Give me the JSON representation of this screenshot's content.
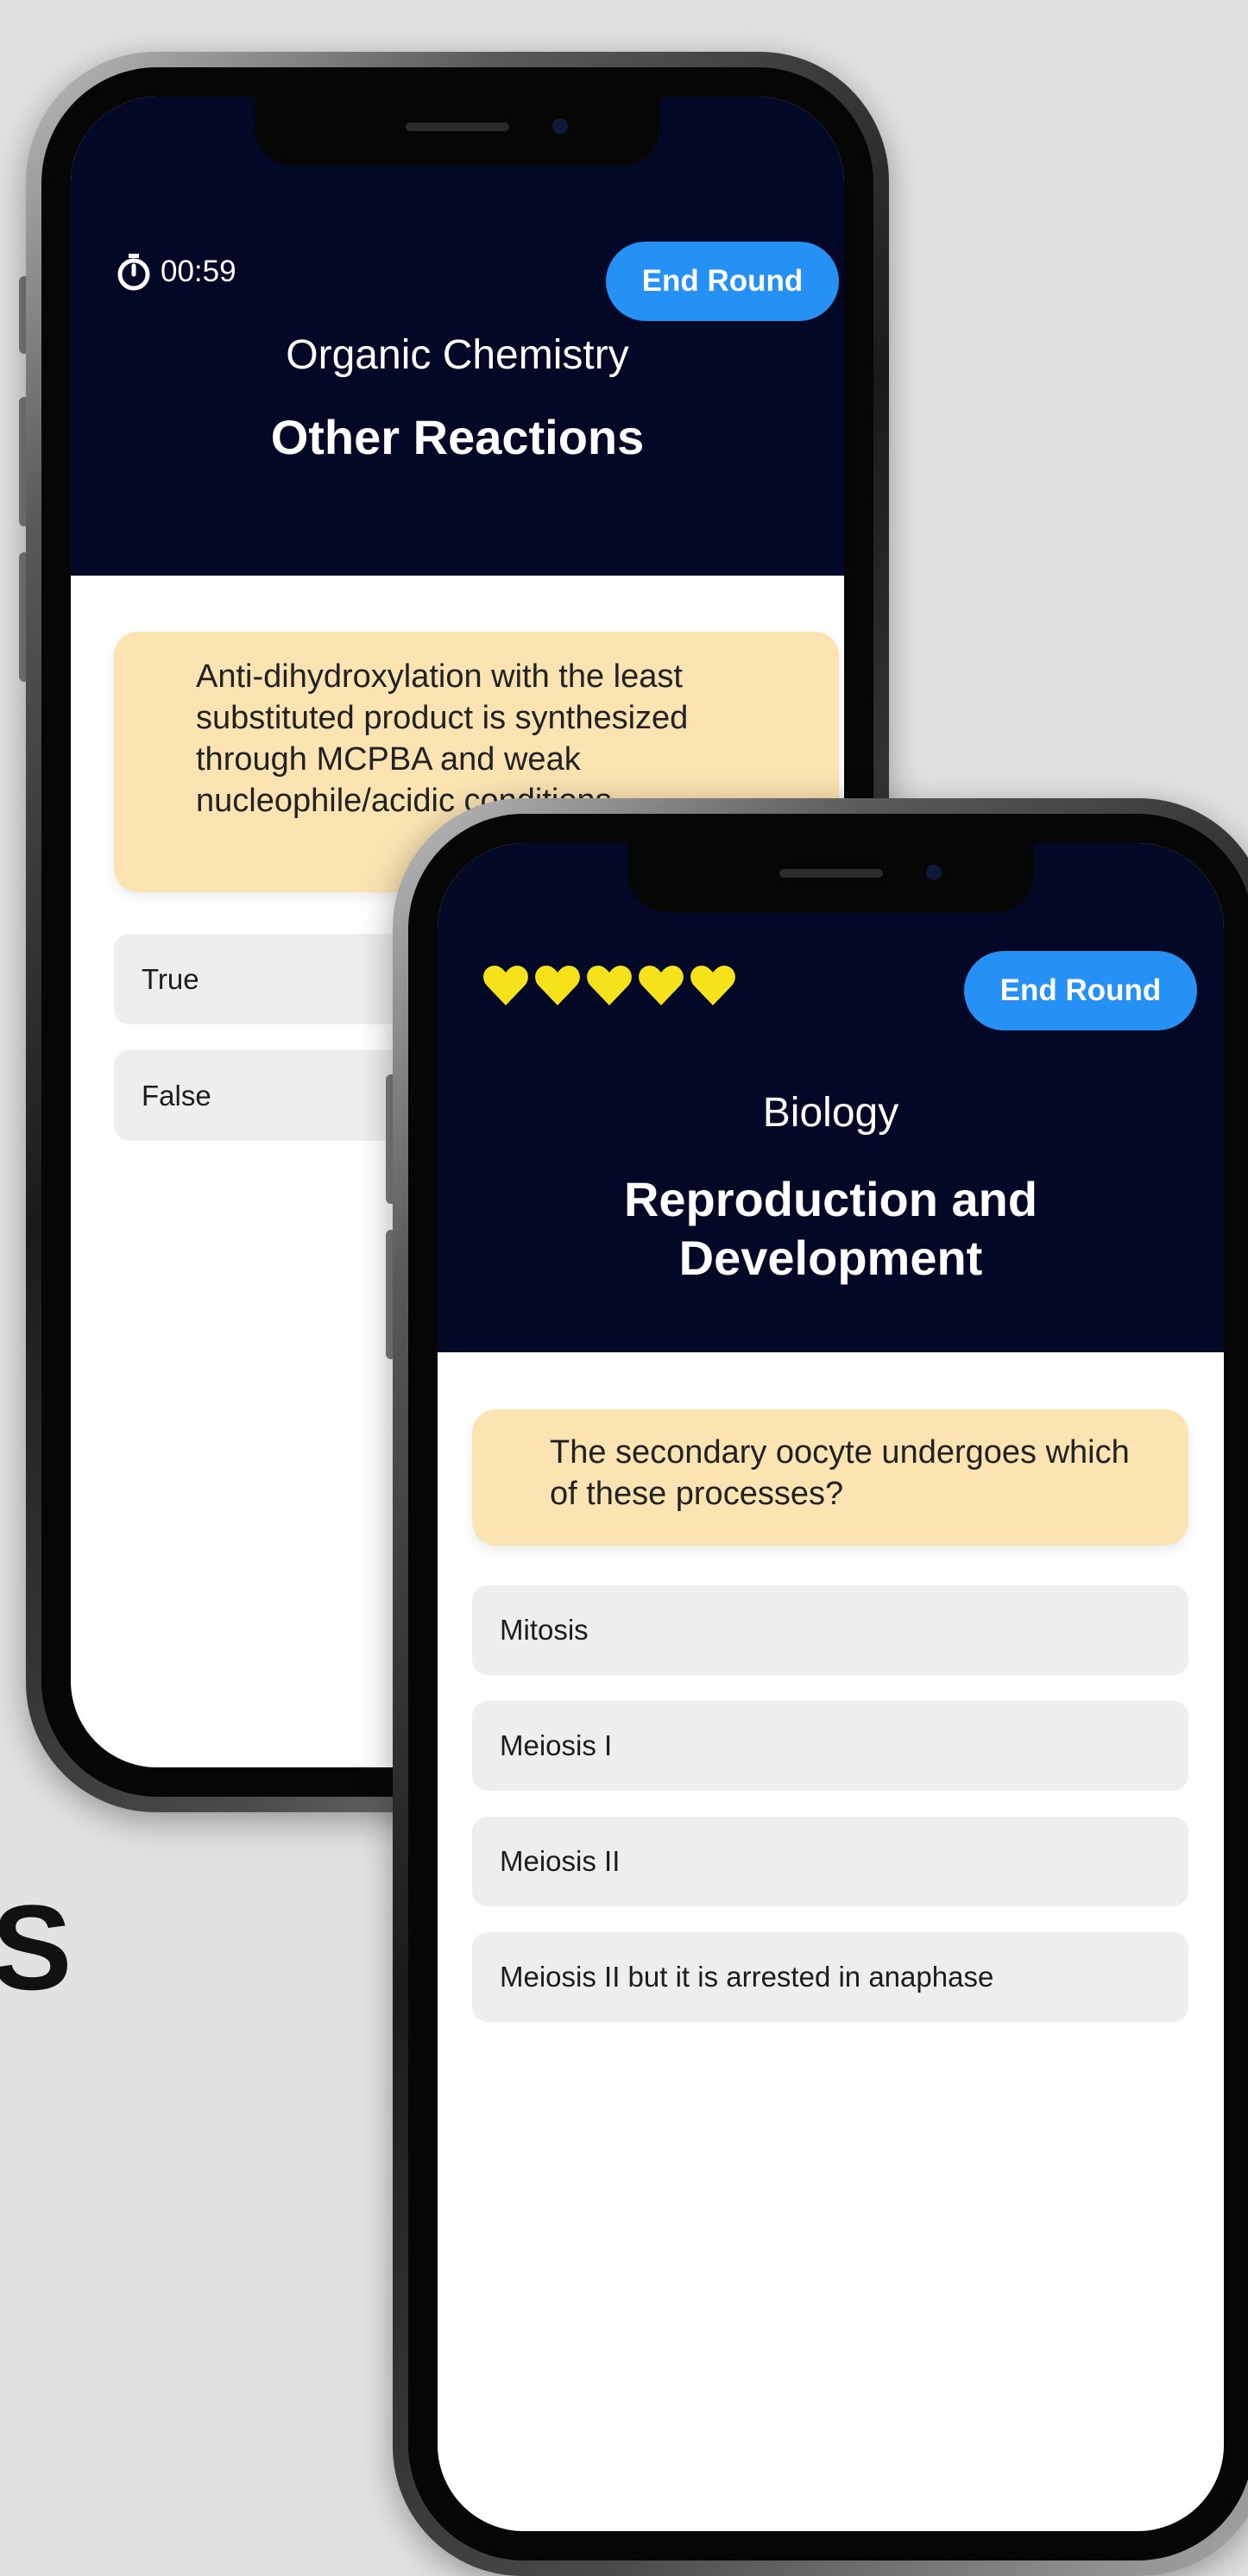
{
  "phone_back": {
    "timer": "00:59",
    "end_round": "End Round",
    "subject": "Organic Chemistry",
    "topic": "Other Reactions",
    "question": "Anti-dihydroxylation with the least substituted product is synthesized through MCPBA and weak nucleophile/acidic conditions.",
    "answers": [
      "True",
      "False"
    ]
  },
  "phone_front": {
    "lives": 5,
    "end_round": "End Round",
    "subject": "Biology",
    "topic_line1": "Reproduction and",
    "topic_line2": "Development",
    "question": "The secondary oocyte undergoes which of these processes?",
    "answers": [
      "Mitosis",
      "Meiosis I",
      "Meiosis II",
      "Meiosis II but it is arrested in anaphase"
    ]
  },
  "background_text": "S",
  "colors": {
    "header": "#020826",
    "accent": "#2591f4",
    "question_card": "#fbe3b2",
    "answer": "#eeeeee",
    "heart": "#f5e21b"
  }
}
